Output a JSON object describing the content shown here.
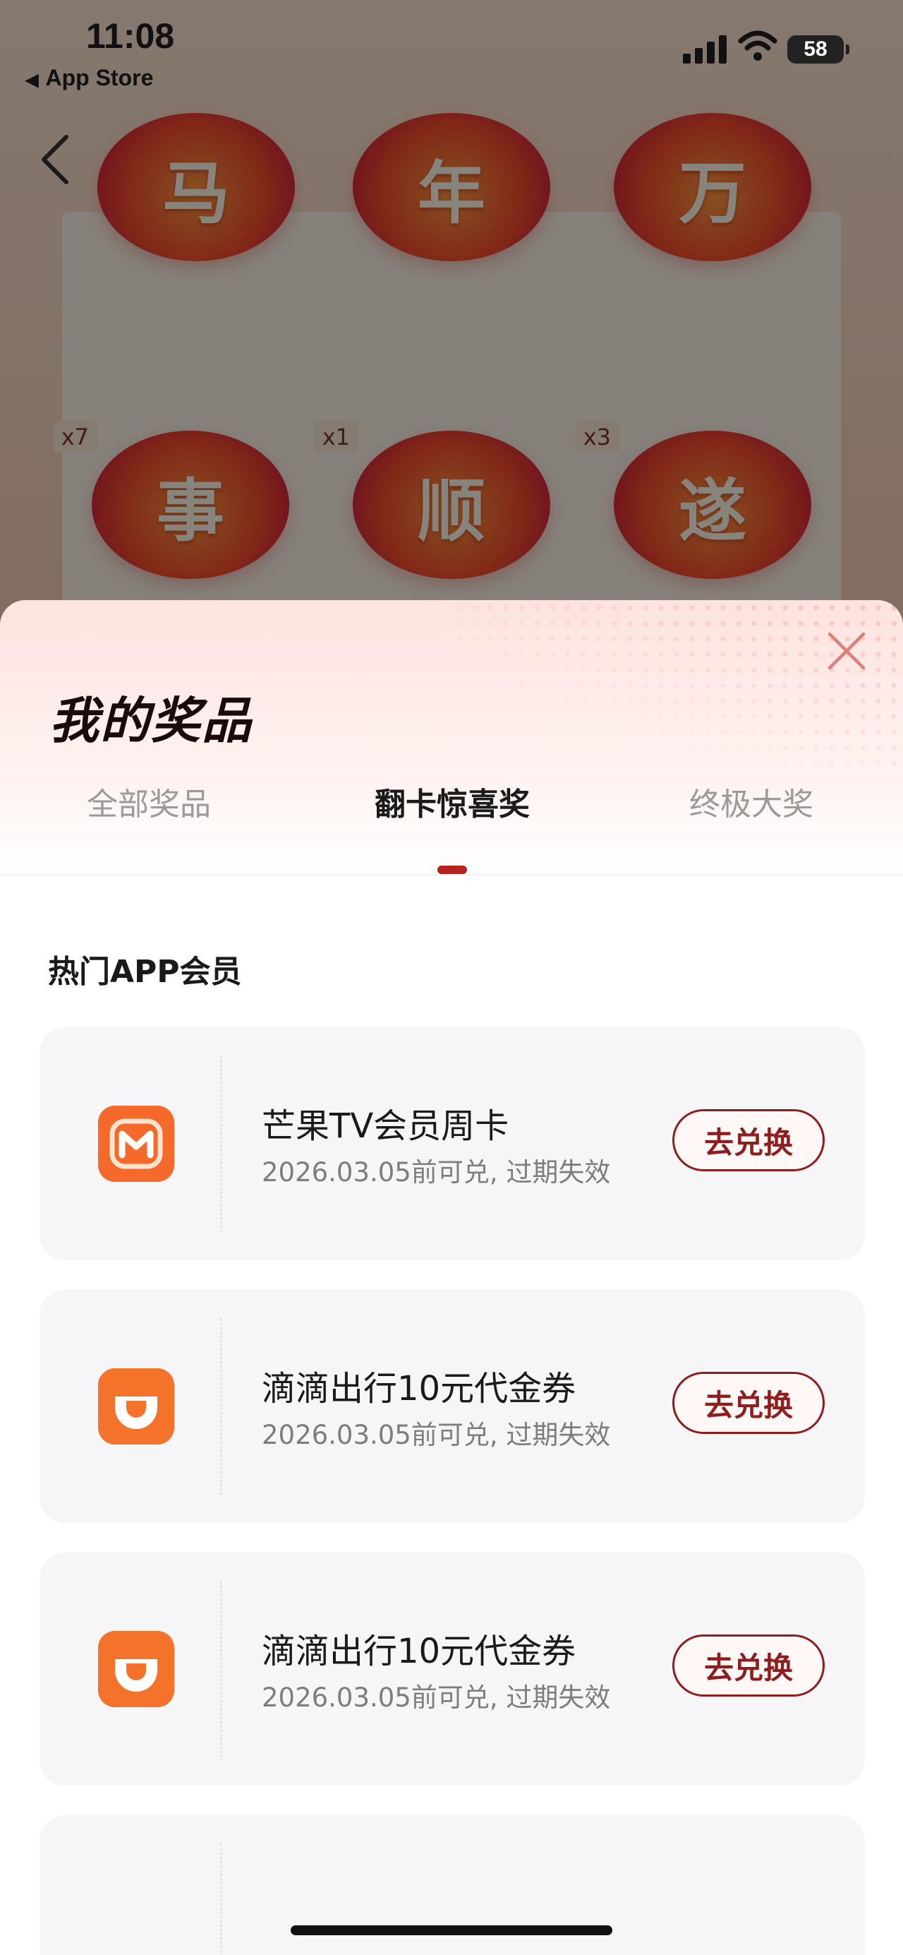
{
  "status_bar": {
    "time": "11:08",
    "back_app": "App Store",
    "battery": "58"
  },
  "background": {
    "tiles": [
      {
        "char": "马",
        "count": ""
      },
      {
        "char": "年",
        "count": ""
      },
      {
        "char": "万",
        "count": ""
      },
      {
        "char": "事",
        "count": "x7"
      },
      {
        "char": "顺",
        "count": "x1"
      },
      {
        "char": "遂",
        "count": "x3"
      }
    ]
  },
  "sheet": {
    "title": "我的奖品",
    "tabs": [
      {
        "label": "全部奖品",
        "active": false
      },
      {
        "label": "翻卡惊喜奖",
        "active": true
      },
      {
        "label": "终极大奖",
        "active": false
      }
    ],
    "section_title": "热门APP会员",
    "prizes": [
      {
        "icon": "mango-tv-icon",
        "name": "芒果TV会员周卡",
        "expiry": "2026.03.05前可兑, 过期失效",
        "button": "去兑换"
      },
      {
        "icon": "didi-icon",
        "name": "滴滴出行10元代金券",
        "expiry": "2026.03.05前可兑, 过期失效",
        "button": "去兑换"
      },
      {
        "icon": "didi-icon",
        "name": "滴滴出行10元代金券",
        "expiry": "2026.03.05前可兑, 过期失效",
        "button": "去兑换"
      }
    ]
  },
  "colors": {
    "accent": "#8e1d1d",
    "tab_indicator": "#b8221d",
    "icon_orange": "#f26a22"
  }
}
